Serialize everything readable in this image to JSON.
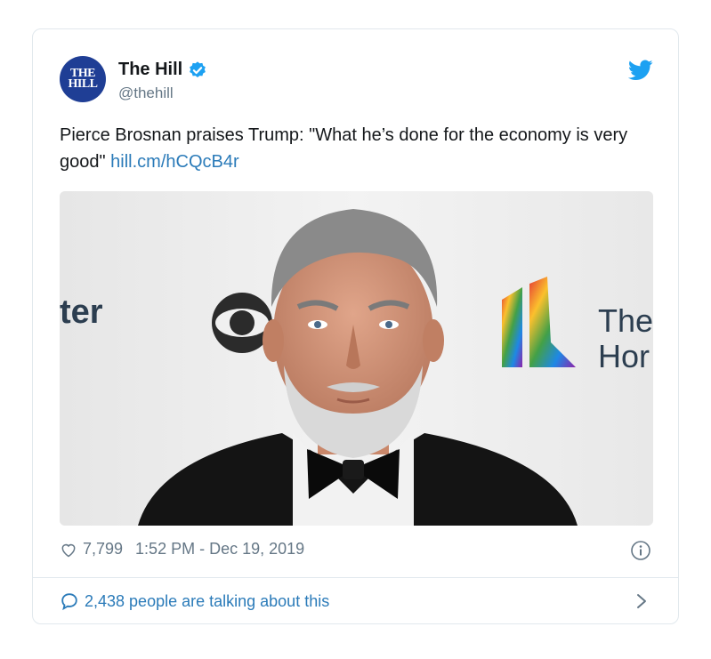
{
  "account": {
    "display_name": "The Hill",
    "handle": "@thehill",
    "avatar_line1": "THE",
    "avatar_line2": "HILL",
    "avatar_color": "#1f3e95"
  },
  "tweet": {
    "text": "Pierce Brosnan praises Trump: \"What he’s done for the economy is very good\"",
    "link": "hill.cm/hCQcB4r",
    "likes": "7,799",
    "timestamp": "1:52 PM - Dec 19, 2019",
    "talking": "2,438 people are talking about this"
  },
  "photo": {
    "bg_text_left": "ter",
    "bg_text_right_1": "The",
    "bg_text_right_2": "Hor"
  },
  "colors": {
    "link": "#2b7bb9",
    "verified": "#1da1f2",
    "muted": "#657786",
    "border": "#e1e8ed"
  },
  "icons": [
    "verified-badge-icon",
    "twitter-bird-icon",
    "heart-icon",
    "info-icon",
    "comment-icon",
    "chevron-right-icon"
  ]
}
